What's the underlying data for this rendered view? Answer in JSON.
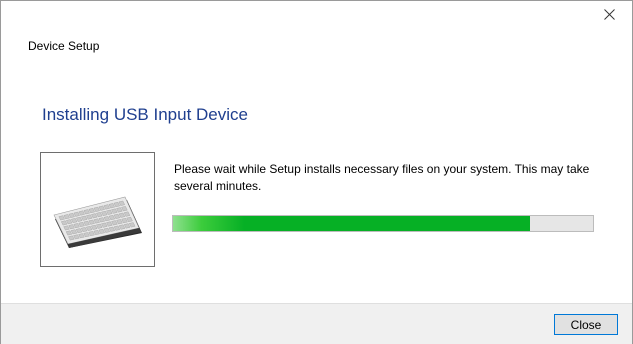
{
  "window": {
    "app_title": "Device Setup",
    "close_icon": "close-icon"
  },
  "main": {
    "heading": "Installing USB Input Device",
    "device_icon": "keyboard-icon",
    "message": "Please wait while Setup installs necessary files on your system. This may take several minutes.",
    "progress": 0.85
  },
  "footer": {
    "close_label": "Close"
  },
  "colors": {
    "heading": "#1f3f8f",
    "progress_fill": "#06b025",
    "button_border": "#0078d7"
  }
}
